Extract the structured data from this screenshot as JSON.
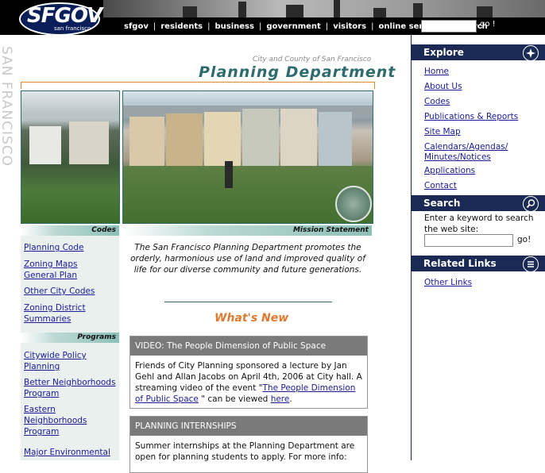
{
  "header": {
    "logo_text": "SFGOV",
    "logo_sub": "san francisco",
    "nav": [
      "sfgov",
      "residents",
      "business",
      "government",
      "visitors",
      "online services",
      "search"
    ],
    "go_label": "go !"
  },
  "left_vertical_text": "SAN FRANCISCO",
  "titles": {
    "city": "City and County of San Francisco",
    "department": "Planning Department"
  },
  "tabs": {
    "codes": "Codes",
    "mission": "Mission Statement",
    "programs": "Programs"
  },
  "codes_links": [
    "Planning Code",
    "Zoning Maps\nGeneral Plan",
    "Other City Codes",
    "Zoning District\nSummaries"
  ],
  "programs_links": [
    "Citywide Policy\nPlanning",
    "Better Neighborhoods\nProgram",
    "Eastern\nNeighborhoods\nProgram",
    "Major Environmental"
  ],
  "mission_text": "The San Francisco Planning Department promotes the orderly, harmonious use of land and improved quality of life for our diverse community and future generations.",
  "whats_new": "What's New",
  "news": [
    {
      "title": "VIDEO: The People Dimension of Public Space",
      "body_pre": "Friends of City Planning sponsored a lecture by Jan Gehl and Allan Jacobs on April 4th, 2006 at City hall. A streaming video of the event \"",
      "link1": "The People Dimension of Public Space",
      "body_mid": " \" can be viewed ",
      "link2": "here",
      "body_post": "."
    },
    {
      "title": "PLANNING INTERNSHIPS",
      "body": "Summer internships at the Planning Department are open for planning students to apply. For more info:"
    }
  ],
  "sidebar": {
    "explore_title": "Explore",
    "explore_links": [
      "Home",
      "About Us",
      "Codes",
      "Publications & Reports",
      "Site Map",
      "Calendars/Agendas/\nMinutes/Notices",
      "Applications",
      "Contact"
    ],
    "search_title": "Search",
    "search_text": "Enter a keyword to search the web site:",
    "search_go": "go!",
    "related_title": "Related Links",
    "related_links": [
      "Other Links"
    ]
  }
}
